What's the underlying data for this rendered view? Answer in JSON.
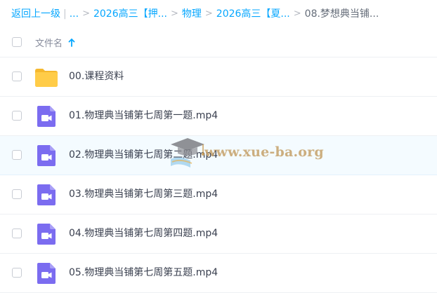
{
  "breadcrumb": {
    "back_label": "返回上一级",
    "ellipsis": "...",
    "items": [
      "2026高三【押...",
      "物理",
      "2026高三【夏..."
    ],
    "current": "08.梦想典当铺..."
  },
  "header": {
    "filename_label": "文件名"
  },
  "files": [
    {
      "name": "00.课程资料",
      "icon": "folder-icon"
    },
    {
      "name": "01.物理典当铺第七周第一题.mp4",
      "icon": "video-file-icon"
    },
    {
      "name": "02.物理典当铺第七周第二题.mp4",
      "icon": "video-file-icon"
    },
    {
      "name": "03.物理典当铺第七周第三题.mp4",
      "icon": "video-file-icon"
    },
    {
      "name": "04.物理典当铺第七周第四题.mp4",
      "icon": "video-file-icon"
    },
    {
      "name": "05.物理典当铺第七周第五题.mp4",
      "icon": "video-file-icon"
    }
  ],
  "watermark": {
    "text": "www.xue-ba.org"
  },
  "colors": {
    "link": "#06a7ff",
    "folder": "#ffc83d",
    "video": "#7b6cf0",
    "hover_row": "#f4fbff"
  }
}
